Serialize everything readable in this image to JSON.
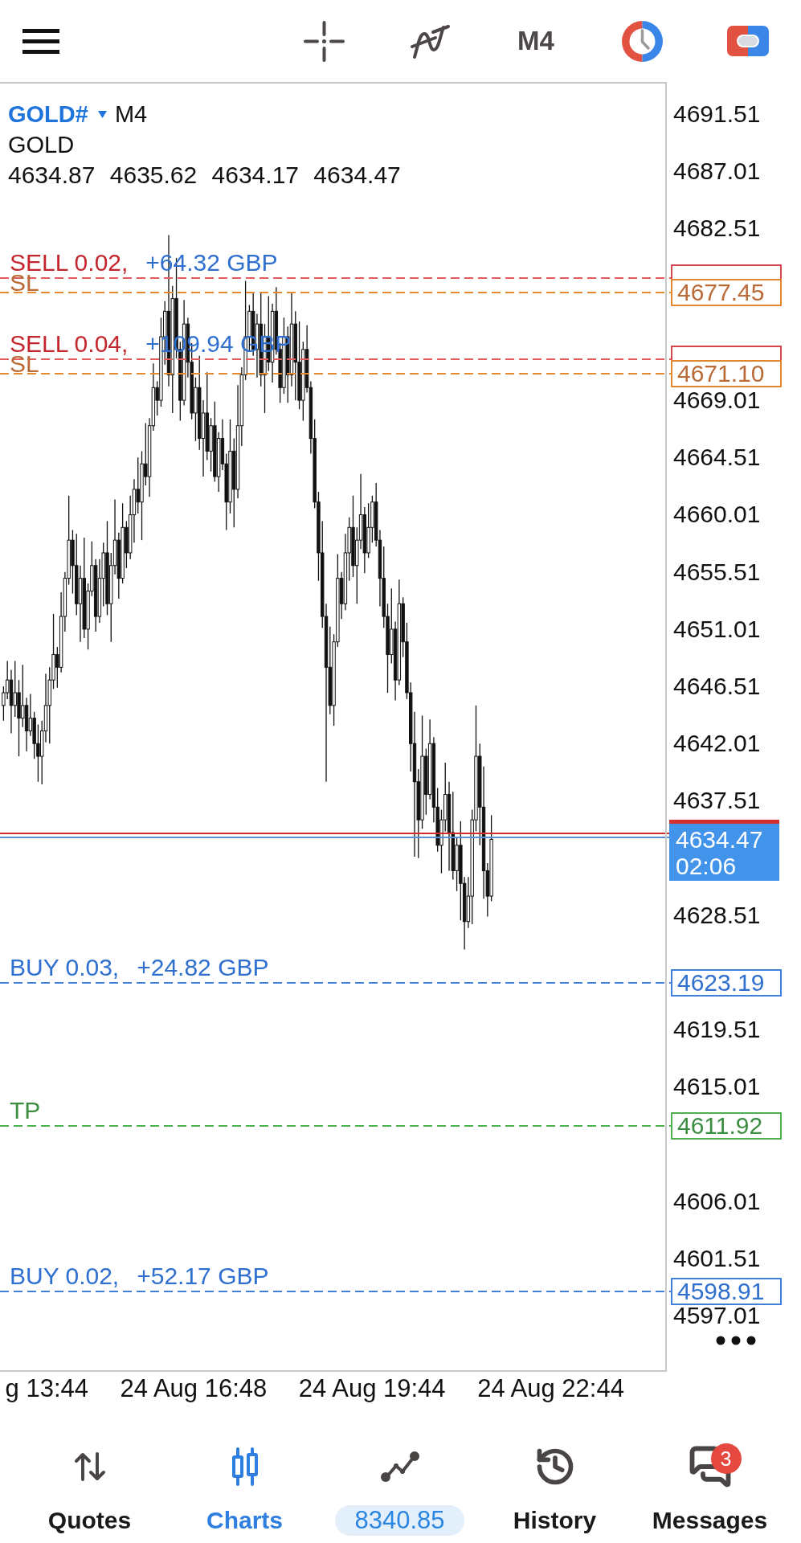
{
  "toolbar": {
    "timeframe": "M4"
  },
  "chart": {
    "symbol": "GOLD#",
    "timeframe": "M4",
    "description": "GOLD",
    "ohlc": "4634.87 4635.62 4634.17 4634.47",
    "price_axis": [
      "4691.51",
      "4687.01",
      "4682.51",
      "4669.01",
      "4664.51",
      "4660.01",
      "4655.51",
      "4651.01",
      "4646.51",
      "4642.01",
      "4637.51",
      "4628.51",
      "4619.51",
      "4615.01",
      "4606.01",
      "4601.51",
      "4597.01"
    ],
    "trade_lines": [
      {
        "kind": "sell",
        "label": "SELL 0.02,",
        "profit": "+64.32 GBP",
        "stop_loss": {
          "label": "SL",
          "price": "4677.45"
        }
      },
      {
        "kind": "sell",
        "label": "SELL 0.04,",
        "profit": "+109.94 GBP",
        "stop_loss": {
          "label": "SL",
          "price": "4671.10"
        }
      },
      {
        "kind": "buy",
        "label": "BUY 0.03,",
        "profit": "+24.82 GBP",
        "price": "4623.19"
      },
      {
        "kind": "take_profit",
        "label": "TP",
        "price": "4611.92"
      },
      {
        "kind": "buy",
        "label": "BUY 0.02,",
        "profit": "+52.17 GBP",
        "price": "4598.91"
      }
    ],
    "current_price": {
      "price": "4634.47",
      "countdown": "02:06"
    },
    "time_axis": [
      "g 13:44",
      "24 Aug 16:48",
      "24 Aug 19:44",
      "24 Aug 22:44"
    ]
  },
  "bottom_nav": [
    {
      "kind": "tab",
      "label": "Quotes",
      "selected": false
    },
    {
      "kind": "tab",
      "label": "Charts",
      "selected": true
    },
    {
      "kind": "balance",
      "label": "8340.85",
      "selected": false
    },
    {
      "kind": "tab",
      "label": "History",
      "selected": false
    },
    {
      "kind": "tab",
      "label": "Messages",
      "selected": false,
      "badge": "3"
    }
  ]
}
